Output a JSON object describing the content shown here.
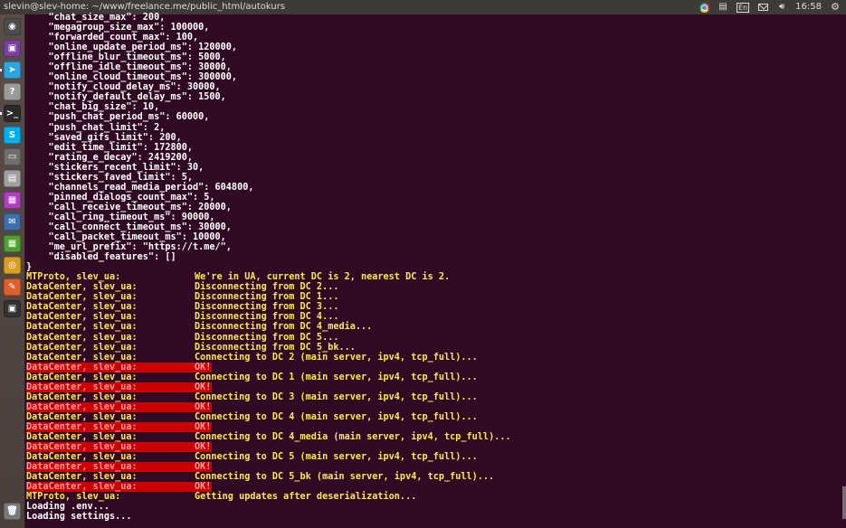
{
  "window": {
    "title": "slevin@slev-home: ~/www/freelance.me/public_html/autokurs"
  },
  "tray": {
    "keyboard": "En",
    "clock": "16:58"
  },
  "launcher": {
    "items": [
      {
        "name": "dash-icon",
        "glyph": "◉",
        "color": "#4c4c4c"
      },
      {
        "name": "image-viewer-icon",
        "glyph": "▣",
        "color": "#7a3fa0"
      },
      {
        "name": "telegram-icon",
        "glyph": "➤",
        "color": "#2ca5e0"
      },
      {
        "name": "help-icon",
        "glyph": "?",
        "color": "#9a9a9a"
      },
      {
        "name": "terminal-icon",
        "glyph": ">_",
        "color": "#2b2b2b"
      },
      {
        "name": "skype-icon",
        "glyph": "S",
        "color": "#00aff0"
      },
      {
        "name": "drive-icon",
        "glyph": "▭",
        "color": "#6e6e6e"
      },
      {
        "name": "files-icon",
        "glyph": "▤",
        "color": "#a0a0a0"
      },
      {
        "name": "phpstorm-icon",
        "glyph": "▦",
        "color": "#b03fc0"
      },
      {
        "name": "thunderbird-icon",
        "glyph": "✉",
        "color": "#3d6fb0"
      },
      {
        "name": "spreadsheet-icon",
        "glyph": "▦",
        "color": "#4fa02f"
      },
      {
        "name": "chrome-icon",
        "glyph": "◎",
        "color": "#d9a020"
      },
      {
        "name": "editor-icon",
        "glyph": "✎",
        "color": "#e0602a"
      },
      {
        "name": "monitor-icon",
        "glyph": "▣",
        "color": "#333333"
      },
      {
        "name": "trash-icon",
        "glyph": "🗑",
        "color": "#7a7a7a"
      }
    ]
  },
  "terminal": {
    "json_lines": [
      "    \"chat_size_max\": 200,",
      "    \"megagroup_size_max\": 100000,",
      "    \"forwarded_count_max\": 100,",
      "    \"online_update_period_ms\": 120000,",
      "    \"offline_blur_timeout_ms\": 5000,",
      "    \"offline_idle_timeout_ms\": 30000,",
      "    \"online_cloud_timeout_ms\": 300000,",
      "    \"notify_cloud_delay_ms\": 30000,",
      "    \"notify_default_delay_ms\": 1500,",
      "    \"chat_big_size\": 10,",
      "    \"push_chat_period_ms\": 60000,",
      "    \"push_chat_limit\": 2,",
      "    \"saved_gifs_limit\": 200,",
      "    \"edit_time_limit\": 172800,",
      "    \"rating_e_decay\": 2419200,",
      "    \"stickers_recent_limit\": 30,",
      "    \"stickers_faved_limit\": 5,",
      "    \"channels_read_media_period\": 604800,",
      "    \"pinned_dialogs_count_max\": 5,",
      "    \"call_receive_timeout_ms\": 20000,",
      "    \"call_ring_timeout_ms\": 90000,",
      "    \"call_connect_timeout_ms\": 30000,",
      "    \"call_packet_timeout_ms\": 10000,",
      "    \"me_url_prefix\": \"https://t.me/\",",
      "    \"disabled_features\": []",
      "}"
    ],
    "log_lines": [
      {
        "label": "MTProto, slev_ua:",
        "msg": "We're in UA, current DC is 2, nearest DC is 2.",
        "hl": false
      },
      {
        "label": "DataCenter, slev_ua:",
        "msg": "Disconnecting from DC 2...",
        "hl": false
      },
      {
        "label": "DataCenter, slev_ua:",
        "msg": "Disconnecting from DC 1...",
        "hl": false
      },
      {
        "label": "DataCenter, slev_ua:",
        "msg": "Disconnecting from DC 3...",
        "hl": false
      },
      {
        "label": "DataCenter, slev_ua:",
        "msg": "Disconnecting from DC 4...",
        "hl": false
      },
      {
        "label": "DataCenter, slev_ua:",
        "msg": "Disconnecting from DC 4_media...",
        "hl": false
      },
      {
        "label": "DataCenter, slev_ua:",
        "msg": "Disconnecting from DC 5...",
        "hl": false
      },
      {
        "label": "DataCenter, slev_ua:",
        "msg": "Disconnecting from DC 5_bk...",
        "hl": false
      },
      {
        "label": "DataCenter, slev_ua:",
        "msg": "Connecting to DC 2 (main server, ipv4, tcp_full)...",
        "hl": false
      },
      {
        "label": "DataCenter, slev_ua:",
        "msg": "OK!",
        "hl": true
      },
      {
        "label": "DataCenter, slev_ua:",
        "msg": "Connecting to DC 1 (main server, ipv4, tcp_full)...",
        "hl": false
      },
      {
        "label": "DataCenter, slev_ua:",
        "msg": "OK!",
        "hl": true
      },
      {
        "label": "DataCenter, slev_ua:",
        "msg": "Connecting to DC 3 (main server, ipv4, tcp_full)...",
        "hl": false
      },
      {
        "label": "DataCenter, slev_ua:",
        "msg": "OK!",
        "hl": true
      },
      {
        "label": "DataCenter, slev_ua:",
        "msg": "Connecting to DC 4 (main server, ipv4, tcp_full)...",
        "hl": false
      },
      {
        "label": "DataCenter, slev_ua:",
        "msg": "OK!",
        "hl": true
      },
      {
        "label": "DataCenter, slev_ua:",
        "msg": "Connecting to DC 4_media (main server, ipv4, tcp_full)...",
        "hl": false
      },
      {
        "label": "DataCenter, slev_ua:",
        "msg": "OK!",
        "hl": true
      },
      {
        "label": "DataCenter, slev_ua:",
        "msg": "Connecting to DC 5 (main server, ipv4, tcp_full)...",
        "hl": false
      },
      {
        "label": "DataCenter, slev_ua:",
        "msg": "OK!",
        "hl": true
      },
      {
        "label": "DataCenter, slev_ua:",
        "msg": "Connecting to DC 5_bk (main server, ipv4, tcp_full)...",
        "hl": false
      },
      {
        "label": "DataCenter, slev_ua:",
        "msg": "OK!",
        "hl": true
      },
      {
        "label": "MTProto, slev_ua:",
        "msg": "Getting updates after deserialization...",
        "hl": false
      }
    ],
    "tail_lines": [
      "Loading .env...",
      "Loading settings..."
    ]
  }
}
